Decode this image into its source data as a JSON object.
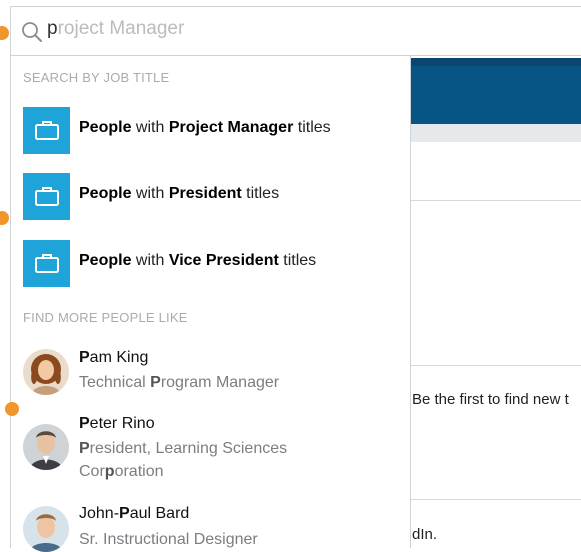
{
  "search": {
    "typed": "p",
    "suggestion": "roject Manager"
  },
  "dropdown": {
    "job_section_header": "SEARCH BY JOB TITLE",
    "job_items": [
      {
        "prefix": "People",
        "mid": " with ",
        "title": "Project Manager",
        "suffix": " titles"
      },
      {
        "prefix": "People",
        "mid": " with ",
        "title": "President",
        "suffix": " titles"
      },
      {
        "prefix": "People",
        "mid": " with ",
        "title": "Vice President",
        "suffix": " titles"
      }
    ],
    "people_section_header": "FIND MORE PEOPLE LIKE",
    "people": [
      {
        "name_bold": "P",
        "name_rest": "am King",
        "title_parts": [
          "Technical ",
          "P",
          "rogram Manager"
        ]
      },
      {
        "name_bold": "P",
        "name_rest": "eter Rino",
        "title_parts": [
          "",
          "P",
          "resident, Learning Sciences Cor",
          "p",
          "oration"
        ]
      },
      {
        "name_pre": "John-",
        "name_bold": "P",
        "name_rest": "aul Bard",
        "title": "Sr. Instructional Designer"
      }
    ]
  },
  "background": {
    "text_1": "Be the first to find new t",
    "text_2": "dIn."
  },
  "colors": {
    "job_icon_bg": "#1ea4d9",
    "header_blue": "#075585",
    "annotation_orange": "#f0962b"
  },
  "icons": [
    "search-icon",
    "briefcase-icon"
  ]
}
